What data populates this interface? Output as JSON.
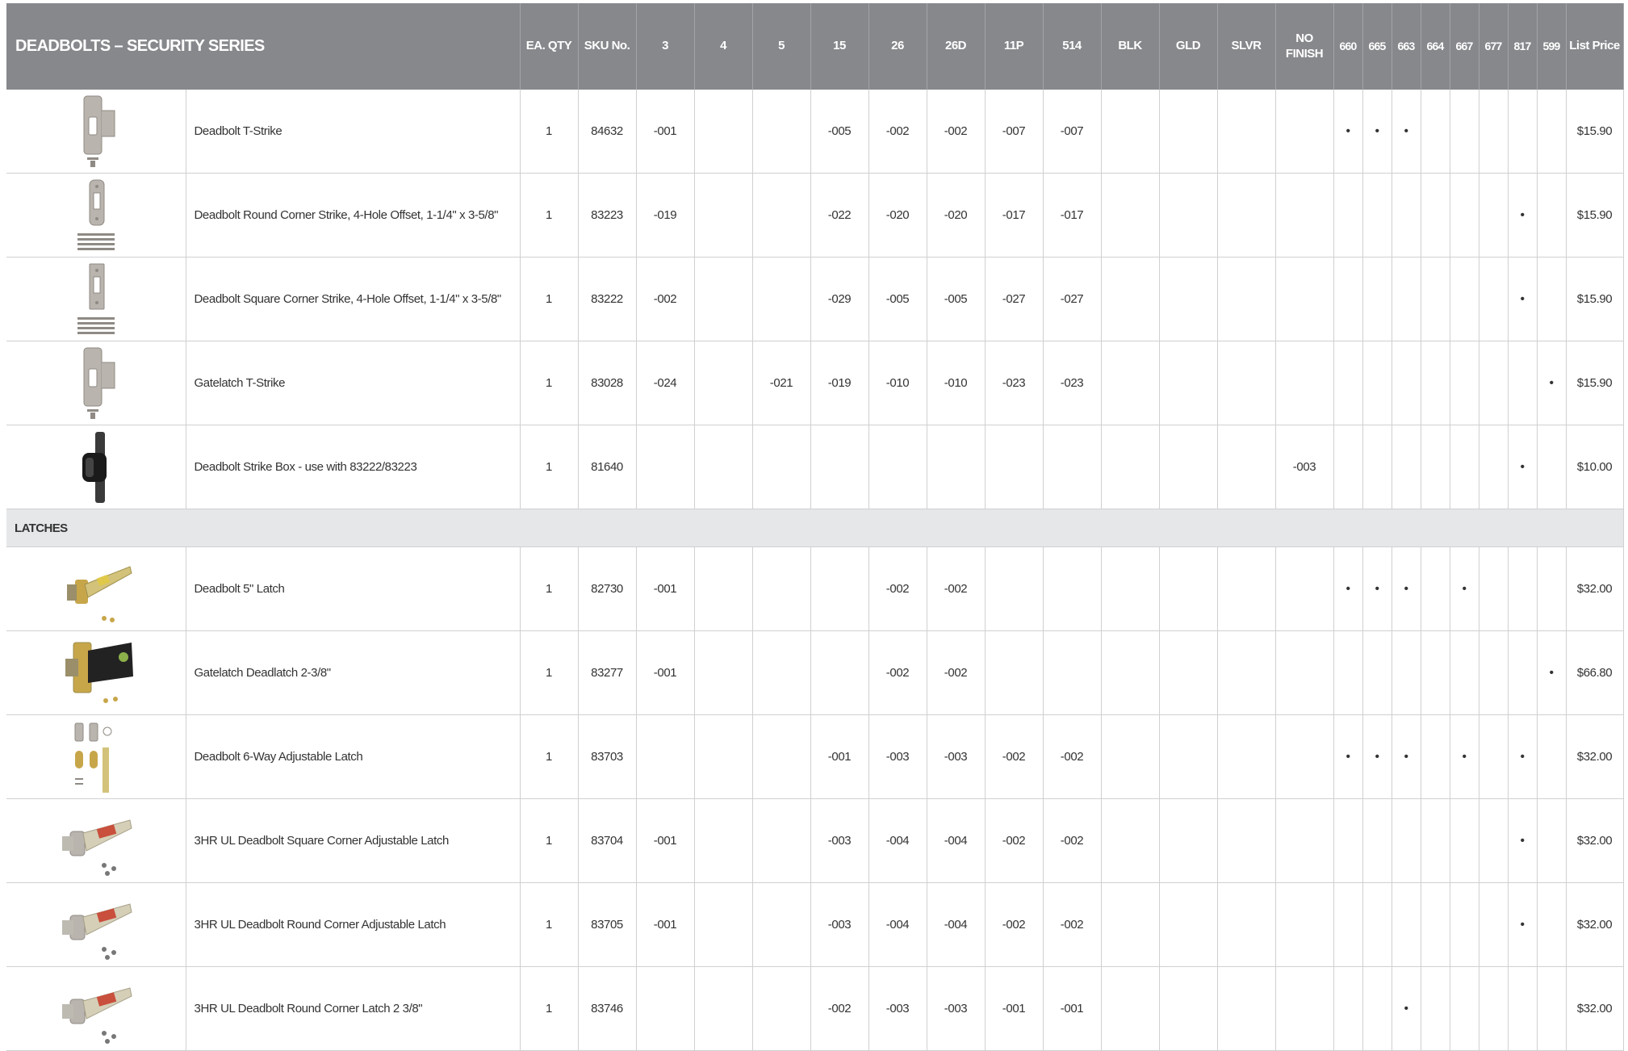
{
  "table": {
    "title": "DEADBOLTS – SECURITY SERIES",
    "columns": [
      "EA. QTY",
      "SKU No.",
      "3",
      "4",
      "5",
      "15",
      "26",
      "26D",
      "11P",
      "514",
      "BLK",
      "GLD",
      "SLVR",
      "NO FINISH",
      "660",
      "665",
      "663",
      "664",
      "667",
      "677",
      "817",
      "599",
      "List Price"
    ],
    "section_title": "LATCHES",
    "rows_top": [
      {
        "name": "Deadbolt T-Strike",
        "qty": "1",
        "sku": "84632",
        "cells": [
          "-001",
          "",
          "",
          "-005",
          "-002",
          "-002",
          "-007",
          "-007",
          "",
          "",
          "",
          ""
        ],
        "dots": [
          "•",
          "•",
          "•",
          "",
          "",
          "",
          "",
          ""
        ],
        "price": "$15.90",
        "icon": "t-strike-icon"
      },
      {
        "name": "Deadbolt Round Corner Strike, 4-Hole Offset, 1-1/4\" x 3-5/8\"",
        "qty": "1",
        "sku": "83223",
        "cells": [
          "-019",
          "",
          "",
          "-022",
          "-020",
          "-020",
          "-017",
          "-017",
          "",
          "",
          "",
          ""
        ],
        "dots": [
          "",
          "",
          "",
          "",
          "",
          "",
          "•",
          ""
        ],
        "price": "$15.90",
        "icon": "round-corner-strike-icon"
      },
      {
        "name": "Deadbolt Square Corner Strike, 4-Hole Offset, 1-1/4\" x 3-5/8\"",
        "qty": "1",
        "sku": "83222",
        "cells": [
          "-002",
          "",
          "",
          "-029",
          "-005",
          "-005",
          "-027",
          "-027",
          "",
          "",
          "",
          ""
        ],
        "dots": [
          "",
          "",
          "",
          "",
          "",
          "",
          "•",
          ""
        ],
        "price": "$15.90",
        "icon": "square-corner-strike-icon"
      },
      {
        "name": "Gatelatch T-Strike",
        "qty": "1",
        "sku": "83028",
        "cells": [
          "-024",
          "",
          "-021",
          "-019",
          "-010",
          "-010",
          "-023",
          "-023",
          "",
          "",
          "",
          ""
        ],
        "dots": [
          "",
          "",
          "",
          "",
          "",
          "",
          "",
          "•"
        ],
        "price": "$15.90",
        "icon": "gatelatch-t-strike-icon"
      },
      {
        "name": "Deadbolt Strike Box - use with 83222/83223",
        "qty": "1",
        "sku": "81640",
        "cells": [
          "",
          "",
          "",
          "",
          "",
          "",
          "",
          "",
          "",
          "",
          "",
          "-003"
        ],
        "dots": [
          "",
          "",
          "",
          "",
          "",
          "",
          "•",
          ""
        ],
        "price": "$10.00",
        "icon": "strike-box-icon"
      }
    ],
    "rows_latches": [
      {
        "name": "Deadbolt 5\" Latch",
        "qty": "1",
        "sku": "82730",
        "cells": [
          "-001",
          "",
          "",
          "",
          "-002",
          "-002",
          "",
          "",
          "",
          "",
          "",
          ""
        ],
        "dots": [
          "•",
          "•",
          "•",
          "",
          "•",
          "",
          "",
          ""
        ],
        "price": "$32.00",
        "icon": "deadbolt-latch-icon"
      },
      {
        "name": "Gatelatch Deadlatch 2-3/8\"",
        "qty": "1",
        "sku": "83277",
        "cells": [
          "-001",
          "",
          "",
          "",
          "-002",
          "-002",
          "",
          "",
          "",
          "",
          "",
          ""
        ],
        "dots": [
          "",
          "",
          "",
          "",
          "",
          "",
          "",
          "•"
        ],
        "price": "$66.80",
        "icon": "deadlatch-icon"
      },
      {
        "name": "Deadbolt 6-Way Adjustable Latch",
        "qty": "1",
        "sku": "83703",
        "cells": [
          "",
          "",
          "",
          "-001",
          "-003",
          "-003",
          "-002",
          "-002",
          "",
          "",
          "",
          ""
        ],
        "dots": [
          "•",
          "•",
          "•",
          "",
          "•",
          "",
          "•",
          ""
        ],
        "price": "$32.00",
        "icon": "adjustable-latch-kit-icon"
      },
      {
        "name": "3HR UL Deadbolt Square Corner Adjustable Latch",
        "qty": "1",
        "sku": "83704",
        "cells": [
          "-001",
          "",
          "",
          "-003",
          "-004",
          "-004",
          "-002",
          "-002",
          "",
          "",
          "",
          ""
        ],
        "dots": [
          "",
          "",
          "",
          "",
          "",
          "",
          "•",
          ""
        ],
        "price": "$32.00",
        "icon": "ul-latch-icon"
      },
      {
        "name": "3HR UL Deadbolt Round Corner Adjustable Latch",
        "qty": "1",
        "sku": "83705",
        "cells": [
          "-001",
          "",
          "",
          "-003",
          "-004",
          "-004",
          "-002",
          "-002",
          "",
          "",
          "",
          ""
        ],
        "dots": [
          "",
          "",
          "",
          "",
          "",
          "",
          "•",
          ""
        ],
        "price": "$32.00",
        "icon": "ul-latch-icon"
      },
      {
        "name": "3HR UL Deadbolt Round Corner Latch 2 3/8\"",
        "qty": "1",
        "sku": "83746",
        "cells": [
          "",
          "",
          "",
          "-002",
          "-003",
          "-003",
          "-001",
          "-001",
          "",
          "",
          "",
          ""
        ],
        "dots": [
          "",
          "",
          "•",
          "",
          "",
          "",
          "",
          ""
        ],
        "price": "$32.00",
        "icon": "ul-latch-icon"
      }
    ]
  },
  "colors": {
    "header_bg": "#87888c",
    "section_bg": "#e6e7e9",
    "grid": "#d0d0d3",
    "text": "#333333"
  }
}
